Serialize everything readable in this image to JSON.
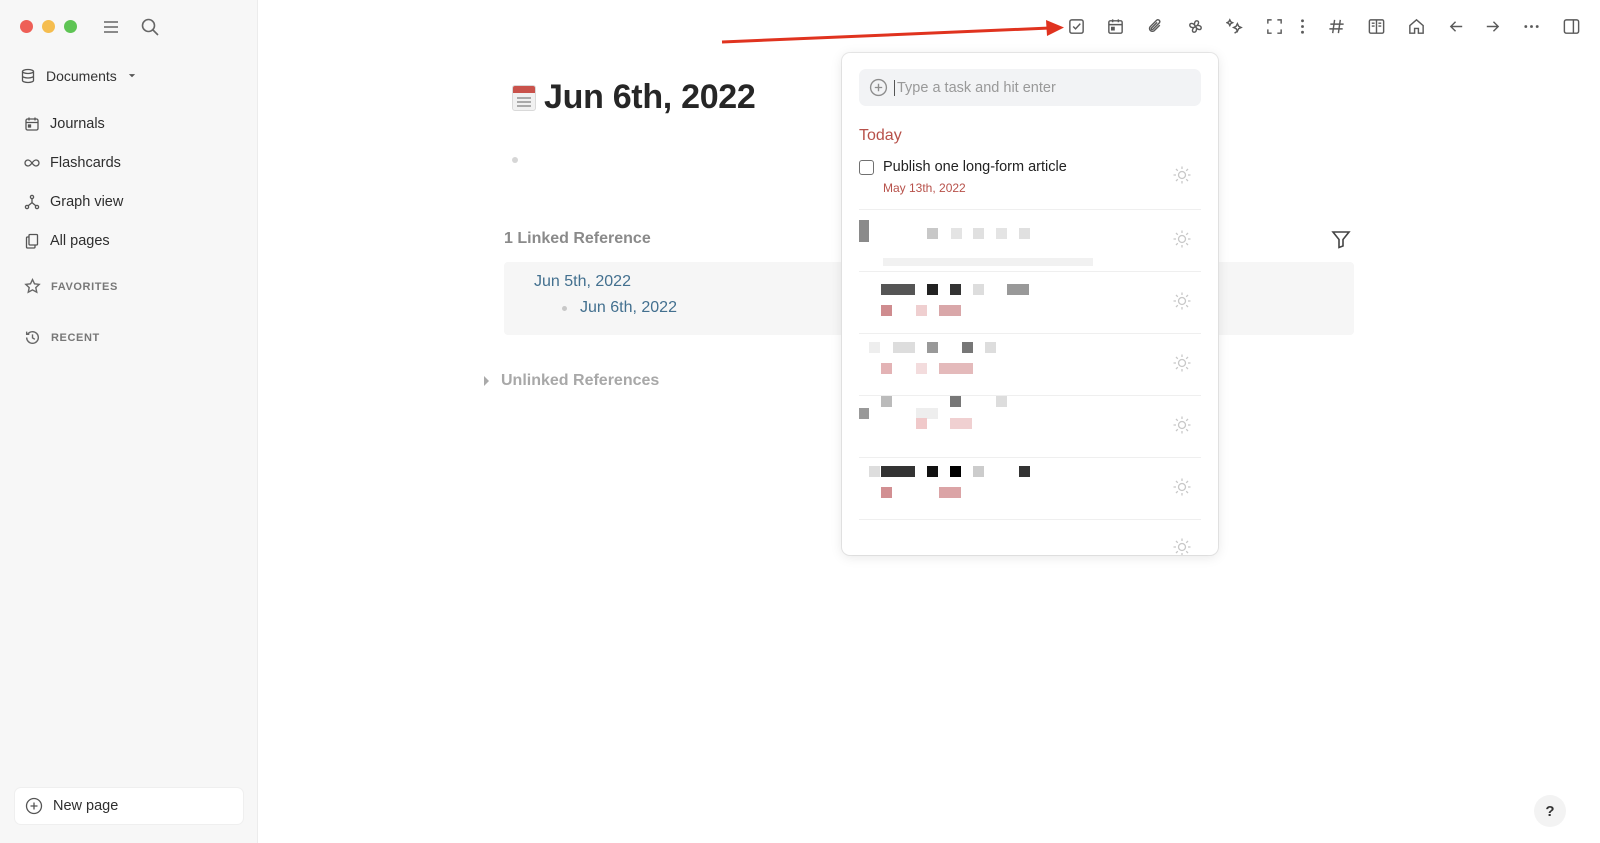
{
  "sidebar": {
    "graph_name": "Documents",
    "nav": [
      {
        "label": "Journals",
        "icon": "calendar-icon"
      },
      {
        "label": "Flashcards",
        "icon": "infinity-icon"
      },
      {
        "label": "Graph view",
        "icon": "graph-icon"
      },
      {
        "label": "All pages",
        "icon": "pages-icon"
      }
    ],
    "favorites_label": "FAVORITES",
    "recent_label": "RECENT",
    "new_page_label": "New page"
  },
  "toolbar": {
    "icons": [
      "task-checkbox-icon",
      "calendar-icon",
      "paperclip-icon",
      "plugin-icon",
      "stars-icon",
      "fullscreen-icon",
      "vertical-dots-icon",
      "hashtag-icon",
      "book-icon",
      "home-icon",
      "back-arrow-icon",
      "forward-arrow-icon",
      "more-icon",
      "right-sidebar-icon"
    ]
  },
  "page": {
    "title": "Jun 6th, 2022",
    "linked_header": "1 Linked Reference",
    "ref_parent": "Jun 5th, 2022",
    "ref_child": "Jun 6th, 2022",
    "unlinked_header": "Unlinked References"
  },
  "task_panel": {
    "input_placeholder": "Type a task and hit enter",
    "section_label": "Today",
    "tasks": [
      {
        "text": "Publish one long-form article",
        "date": "May 13th, 2022"
      }
    ]
  },
  "help_label": "?",
  "colors": {
    "accent_red": "#b7514a",
    "link_blue": "#43708f",
    "annotation_arrow": "#e0331f"
  }
}
